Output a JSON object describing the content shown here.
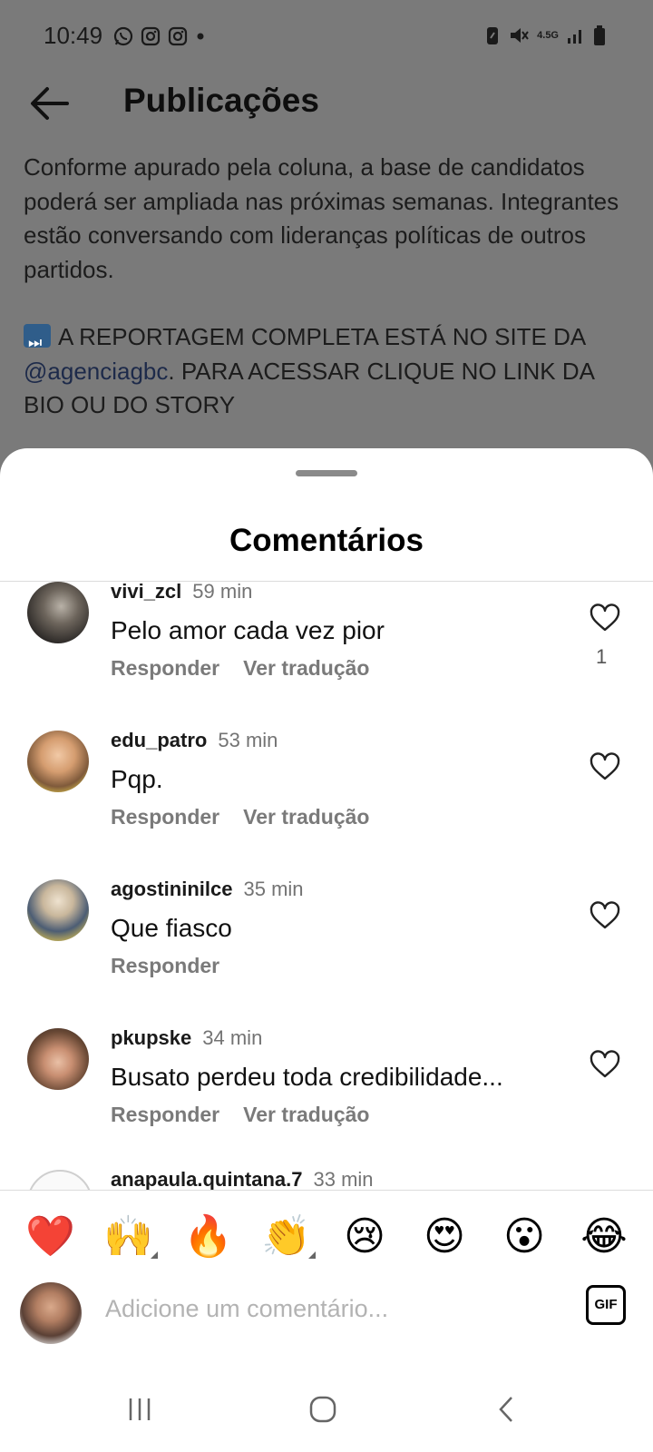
{
  "status_bar": {
    "time": "10:49",
    "network": "4.5G"
  },
  "header": {
    "title": "Publicações"
  },
  "caption": {
    "paragraph1": "Conforme apurado pela coluna, a base de candidatos poderá ser ampliada nas próximas semanas. Integrantes estão conversando com lideranças políticas de outros partidos.",
    "line_a": "A REPORTAGEM COMPLETA ESTÁ NO SITE DA",
    "link": "@agenciagbc",
    "line_b": ". PARA ACESSAR CLIQUE NO LINK DA BIO OU DO STORY"
  },
  "sheet": {
    "title": "Comentários"
  },
  "comments": [
    {
      "user": "vivi_zcl",
      "time": "59 min",
      "text": "Pelo amor cada vez pior",
      "reply": "Responder",
      "translate": "Ver tradução",
      "likes": "1"
    },
    {
      "user": "edu_patro",
      "time": "53 min",
      "text": "Pqp.",
      "reply": "Responder",
      "translate": "Ver tradução"
    },
    {
      "user": "agostininilce",
      "time": "35 min",
      "text": "Que fiasco",
      "reply": "Responder"
    },
    {
      "user": "pkupske",
      "time": "34 min",
      "text": "Busato perdeu toda credibilidade...",
      "reply": "Responder",
      "translate": "Ver tradução"
    },
    {
      "user": "anapaula.quintana.7",
      "time": "33 min"
    }
  ],
  "emoji_bar": [
    "❤️",
    "🙌",
    "🔥",
    "👏",
    "😢",
    "😍",
    "😮",
    "😂"
  ],
  "composer": {
    "placeholder": "Adicione um comentário...",
    "gif_label": "GIF"
  },
  "colors": {
    "overlay": "#7a7a7a",
    "sheet": "#ffffff",
    "secondary_text": "#737373"
  },
  "icons": [
    "whatsapp-icon",
    "instagram-icon",
    "battery-icon",
    "mute-icon",
    "signal-icon",
    "back-arrow-icon",
    "heart-icon",
    "gif-icon",
    "recent-apps-icon",
    "home-icon",
    "nav-back-icon"
  ]
}
